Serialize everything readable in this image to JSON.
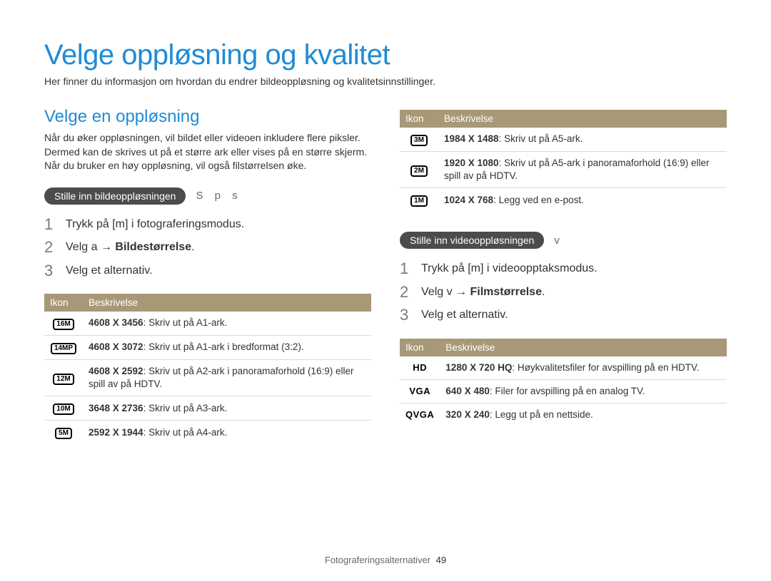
{
  "title": "Velge oppløsning og kvalitet",
  "subtitle": "Her finner du informasjon om hvordan du endrer bildeoppløsning og kvalitetsinnstillinger.",
  "left": {
    "section": "Velge en oppløsning",
    "intro": "Når du øker oppløsningen, vil bildet eller videoen inkludere flere piksler. Dermed kan de skrives ut på et større ark eller vises på en større skjerm. Når du bruker en høy oppløsning, vil også filstørrelsen øke.",
    "pill": "Stille inn bildeoppløsningen",
    "modes": "S   p   s",
    "step1_pre": "Trykk på [",
    "step1_mid": "m",
    "step1_post": "] i fotograferingsmodus.",
    "step2_pre": "Velg ",
    "step2_sym": "a",
    "step2_arrow": " → ",
    "step2_b": "Bildestørrelse",
    "step2_dot": ".",
    "step3": "Velg et alternativ.",
    "th_icon": "Ikon",
    "th_desc": "Beskrivelse",
    "rows": [
      {
        "icon": "16M",
        "b": "4608 X 3456",
        "rest": ": Skriv ut på A1-ark."
      },
      {
        "icon": "14MP",
        "b": "4608 X 3072",
        "rest": ": Skriv ut på A1-ark i bredformat (3:2)."
      },
      {
        "icon": "12M",
        "b": "4608 X 2592",
        "rest": ": Skriv ut på A2-ark i panoramaforhold (16:9) eller spill av på HDTV."
      },
      {
        "icon": "10M",
        "b": "3648 X 2736",
        "rest": ": Skriv ut på A3-ark."
      },
      {
        "icon": "5M",
        "b": "2592 X 1944",
        "rest": ": Skriv ut på A4-ark."
      }
    ]
  },
  "right": {
    "top_th_icon": "Ikon",
    "top_th_desc": "Beskrivelse",
    "top_rows": [
      {
        "icon": "3M",
        "b": "1984 X 1488",
        "rest": ": Skriv ut på A5-ark."
      },
      {
        "icon": "2M",
        "b": "1920 X 1080",
        "rest": ": Skriv ut på A5-ark i panoramaforhold (16:9) eller spill av på HDTV."
      },
      {
        "icon": "1M",
        "b": "1024 X 768",
        "rest": ": Legg ved en e-post."
      }
    ],
    "pill": "Stille inn videooppløsningen",
    "modes": "v",
    "step1_pre": "Trykk på [",
    "step1_mid": "m",
    "step1_post": "] i videoopptaksmodus.",
    "step2_pre": "Velg ",
    "step2_sym": "v",
    "step2_arrow": " → ",
    "step2_b": "Filmstørrelse",
    "step2_dot": ".",
    "step3": "Velg et alternativ.",
    "th_icon": "Ikon",
    "th_desc": "Beskrivelse",
    "rows": [
      {
        "icon": "HD",
        "b": "1280 X 720 HQ",
        "rest": ": Høykvalitetsfiler for avspilling på en HDTV.",
        "icontype": "text"
      },
      {
        "icon": "VGA",
        "b": "640 X 480",
        "rest": ": Filer for avspilling på en analog TV.",
        "icontype": "text"
      },
      {
        "icon": "QVGA",
        "b": "320 X 240",
        "rest": ": Legg ut på en nettside.",
        "icontype": "text"
      }
    ]
  },
  "footer_text": "Fotograferingsalternativer",
  "footer_page": "49"
}
